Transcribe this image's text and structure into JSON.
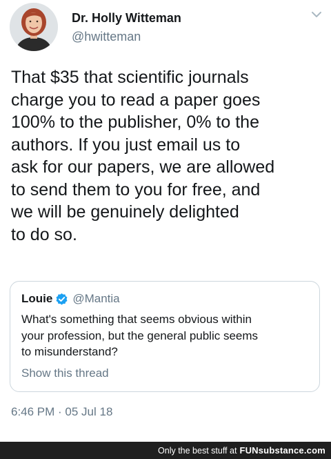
{
  "author": {
    "name": "Dr. Holly Witteman",
    "handle": "@hwitteman"
  },
  "tweet": {
    "text": "That $35 that scientific journals\ncharge you to read a paper goes\n100% to the publisher, 0% to the\nauthors. If you just email us to\nask for our papers, we are allowed\nto send them to you for free, and\nwe will be genuinely delighted\nto do so.",
    "timestamp": "6:46 PM · 05 Jul 18"
  },
  "quoted": {
    "name": "Louie",
    "handle": "@Mantia",
    "text": "What's something that seems obvious within\nyour profession, but the general public seems\nto misunderstand?",
    "thread_link": "Show this thread",
    "verified": true
  },
  "footer": {
    "tagline": "Only the best stuff at",
    "logo": "FUNsubstance.com"
  },
  "colors": {
    "text": "#14171a",
    "secondary": "#657786",
    "verified": "#1da1f2",
    "border": "#ccd6dd",
    "footer_bg": "#1f1f1f"
  },
  "icons": {
    "menu": "chevron-down-icon",
    "verified": "verified-badge-icon"
  }
}
